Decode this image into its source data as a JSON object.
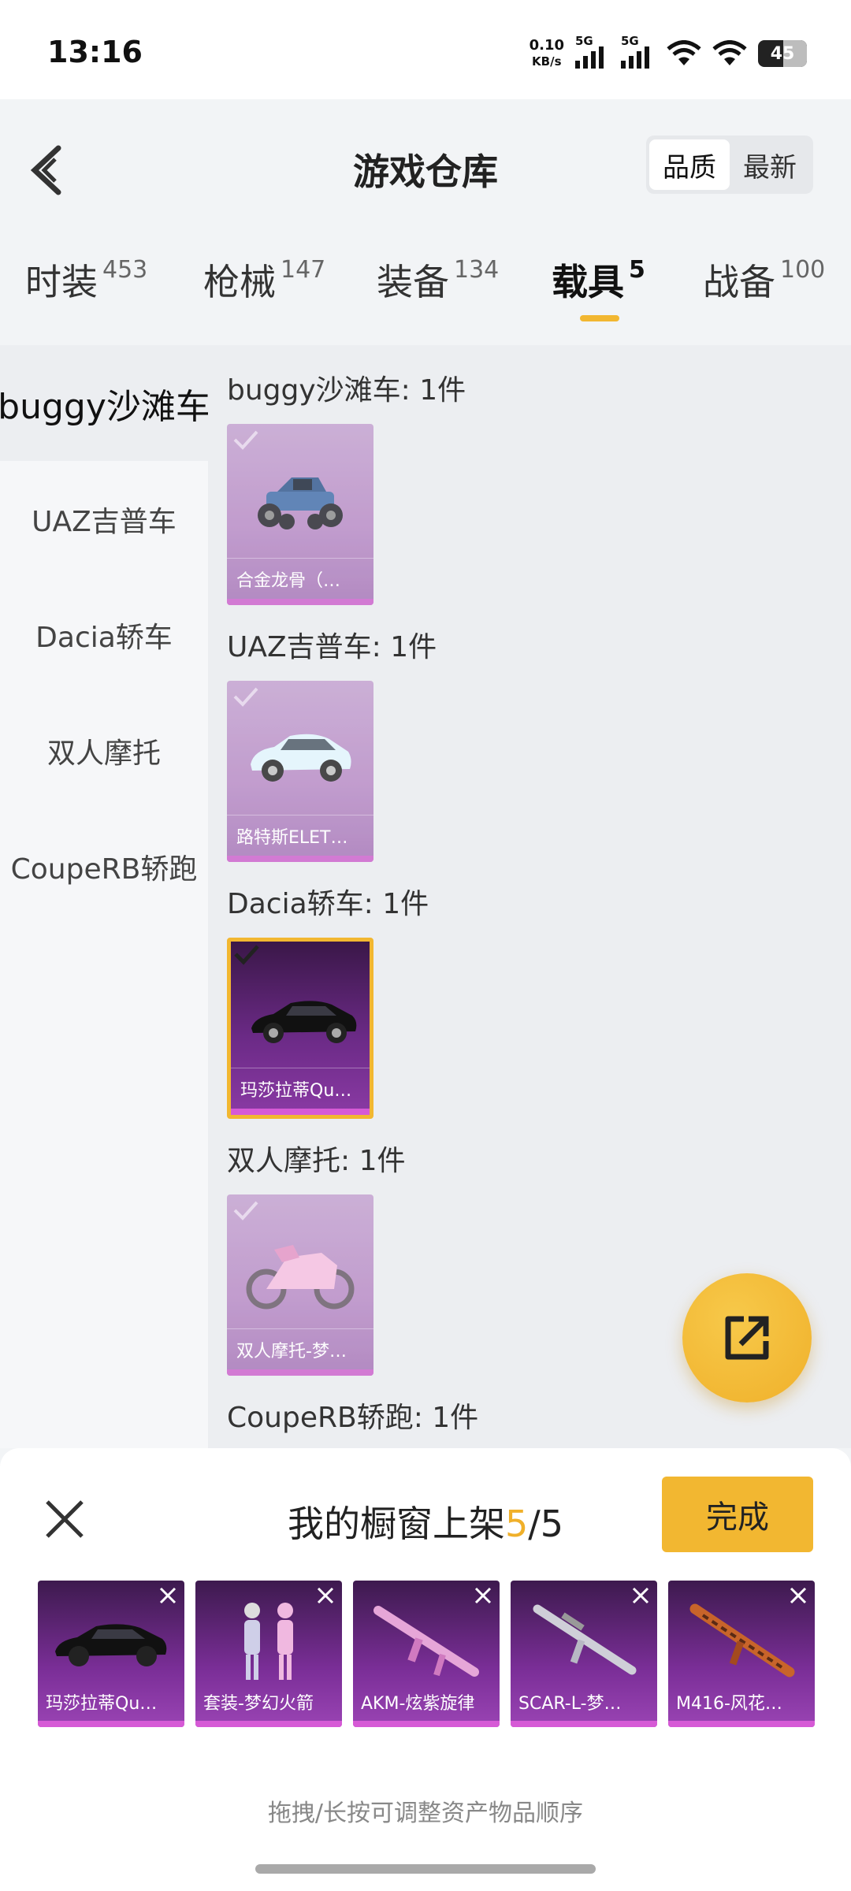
{
  "status_bar": {
    "time": "13:16",
    "net_speed_value": "0.10",
    "net_speed_unit": "KB/s",
    "signal_1_label": "5G",
    "signal_2_label": "5G",
    "battery": "45"
  },
  "header": {
    "title": "游戏仓库",
    "sort_options": [
      "品质",
      "最新"
    ],
    "sort_active": "品质"
  },
  "tabs": [
    {
      "label": "时装",
      "count": "453"
    },
    {
      "label": "枪械",
      "count": "147"
    },
    {
      "label": "装备",
      "count": "134"
    },
    {
      "label": "载具",
      "count": "5",
      "active": true
    },
    {
      "label": "战备",
      "count": "100"
    }
  ],
  "categories": [
    {
      "label": "buggy沙滩车",
      "active": true
    },
    {
      "label": "UAZ吉普车"
    },
    {
      "label": "Dacia轿车"
    },
    {
      "label": "双人摩托"
    },
    {
      "label": "CoupeRB轿跑"
    }
  ],
  "groups": [
    {
      "title": "buggy沙滩车: 1件",
      "item_name": "合金龙骨（…",
      "selected": false
    },
    {
      "title": "UAZ吉普车: 1件",
      "item_name": "路特斯ELET…",
      "selected": false
    },
    {
      "title": "Dacia轿车: 1件",
      "item_name": "玛莎拉蒂Qu…",
      "selected": true
    },
    {
      "title": "双人摩托: 1件",
      "item_name": "双人摩托-梦…",
      "selected": false
    },
    {
      "title": "CoupeRB轿跑: 1件"
    }
  ],
  "showcase": {
    "title_prefix": "我的橱窗上架",
    "current": "5",
    "separator": "/",
    "max": "5",
    "done_label": "完成",
    "items": [
      {
        "name": "玛莎拉蒂Qu…"
      },
      {
        "name": "套装-梦幻火箭"
      },
      {
        "name": "AKM-炫紫旋律"
      },
      {
        "name": "SCAR-L-梦…"
      },
      {
        "name": "M416-风花…"
      }
    ],
    "hint": "拖拽/长按可调整资产物品顺序"
  },
  "colors": {
    "accent": "#f2b731",
    "rarity_bar": "#d65ad6"
  }
}
